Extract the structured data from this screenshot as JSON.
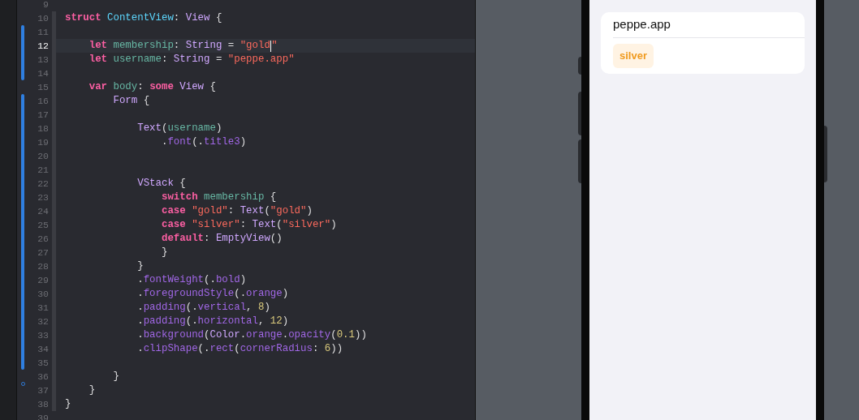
{
  "editor": {
    "lines": [
      {
        "number": "9",
        "current": false,
        "changed": false,
        "deleted": false,
        "fold": false
      },
      {
        "number": "10",
        "current": false,
        "changed": false,
        "deleted": false,
        "fold": true,
        "tokens": [
          {
            "kind": "keyword",
            "text": "struct"
          },
          {
            "kind": "decl",
            "text": " ContentView"
          },
          {
            "kind": "plain",
            "text": ": "
          },
          {
            "kind": "type",
            "text": "View"
          },
          {
            "kind": "plain",
            "text": " {"
          }
        ]
      },
      {
        "number": "11",
        "current": false,
        "changed": true,
        "deleted": false,
        "fold": true
      },
      {
        "number": "12",
        "current": true,
        "changed": true,
        "deleted": false,
        "fold": true,
        "tokens": [
          {
            "kind": "keyword",
            "text": "    let"
          },
          {
            "kind": "ident",
            "text": " membership"
          },
          {
            "kind": "plain",
            "text": ": "
          },
          {
            "kind": "type",
            "text": "String"
          },
          {
            "kind": "plain",
            "text": " = "
          },
          {
            "kind": "string",
            "text": "\"gold",
            "cursor": true
          },
          {
            "kind": "string",
            "text": "\""
          }
        ]
      },
      {
        "number": "13",
        "current": false,
        "changed": true,
        "deleted": false,
        "fold": true,
        "tokens": [
          {
            "kind": "keyword",
            "text": "    let"
          },
          {
            "kind": "ident",
            "text": " username"
          },
          {
            "kind": "plain",
            "text": ": "
          },
          {
            "kind": "type",
            "text": "String"
          },
          {
            "kind": "plain",
            "text": " = "
          },
          {
            "kind": "string",
            "text": "\"peppe.app\""
          }
        ]
      },
      {
        "number": "14",
        "current": false,
        "changed": true,
        "deleted": false,
        "fold": true
      },
      {
        "number": "15",
        "current": false,
        "changed": false,
        "deleted": false,
        "fold": true,
        "tokens": [
          {
            "kind": "keyword",
            "text": "    var"
          },
          {
            "kind": "ident",
            "text": " body"
          },
          {
            "kind": "plain",
            "text": ": "
          },
          {
            "kind": "keyword",
            "text": "some"
          },
          {
            "kind": "type",
            "text": " View"
          },
          {
            "kind": "plain",
            "text": " {"
          }
        ]
      },
      {
        "number": "16",
        "current": false,
        "changed": true,
        "deleted": false,
        "fold": true,
        "tokens": [
          {
            "kind": "type",
            "text": "        Form"
          },
          {
            "kind": "plain",
            "text": " {"
          }
        ]
      },
      {
        "number": "17",
        "current": false,
        "changed": true,
        "deleted": false,
        "fold": true
      },
      {
        "number": "18",
        "current": false,
        "changed": true,
        "deleted": false,
        "fold": true,
        "tokens": [
          {
            "kind": "type",
            "text": "            Text"
          },
          {
            "kind": "plain",
            "text": "("
          },
          {
            "kind": "ident",
            "text": "username"
          },
          {
            "kind": "plain",
            "text": ")"
          }
        ]
      },
      {
        "number": "19",
        "current": false,
        "changed": true,
        "deleted": false,
        "fold": true,
        "tokens": [
          {
            "kind": "plain",
            "text": "                ."
          },
          {
            "kind": "member",
            "text": "font"
          },
          {
            "kind": "plain",
            "text": "(."
          },
          {
            "kind": "member",
            "text": "title3"
          },
          {
            "kind": "plain",
            "text": ")"
          }
        ]
      },
      {
        "number": "20",
        "current": false,
        "changed": true,
        "deleted": false,
        "fold": true
      },
      {
        "number": "21",
        "current": false,
        "changed": true,
        "deleted": false,
        "fold": true
      },
      {
        "number": "22",
        "current": false,
        "changed": true,
        "deleted": false,
        "fold": true,
        "tokens": [
          {
            "kind": "type",
            "text": "            VStack"
          },
          {
            "kind": "plain",
            "text": " {"
          }
        ]
      },
      {
        "number": "23",
        "current": false,
        "changed": true,
        "deleted": false,
        "fold": true,
        "tokens": [
          {
            "kind": "keyword",
            "text": "                switch"
          },
          {
            "kind": "ident",
            "text": " membership"
          },
          {
            "kind": "plain",
            "text": " {"
          }
        ]
      },
      {
        "number": "24",
        "current": false,
        "changed": true,
        "deleted": false,
        "fold": true,
        "tokens": [
          {
            "kind": "keyword",
            "text": "                case"
          },
          {
            "kind": "string",
            "text": " \"gold\""
          },
          {
            "kind": "plain",
            "text": ": "
          },
          {
            "kind": "type",
            "text": "Text"
          },
          {
            "kind": "plain",
            "text": "("
          },
          {
            "kind": "string",
            "text": "\"gold\""
          },
          {
            "kind": "plain",
            "text": ")"
          }
        ]
      },
      {
        "number": "25",
        "current": false,
        "changed": true,
        "deleted": false,
        "fold": true,
        "tokens": [
          {
            "kind": "keyword",
            "text": "                case"
          },
          {
            "kind": "string",
            "text": " \"silver\""
          },
          {
            "kind": "plain",
            "text": ": "
          },
          {
            "kind": "type",
            "text": "Text"
          },
          {
            "kind": "plain",
            "text": "("
          },
          {
            "kind": "string",
            "text": "\"silver\""
          },
          {
            "kind": "plain",
            "text": ")"
          }
        ]
      },
      {
        "number": "26",
        "current": false,
        "changed": true,
        "deleted": false,
        "fold": true,
        "tokens": [
          {
            "kind": "keyword",
            "text": "                default"
          },
          {
            "kind": "plain",
            "text": ": "
          },
          {
            "kind": "type",
            "text": "EmptyView"
          },
          {
            "kind": "plain",
            "text": "()"
          }
        ]
      },
      {
        "number": "27",
        "current": false,
        "changed": true,
        "deleted": false,
        "fold": true,
        "tokens": [
          {
            "kind": "plain",
            "text": "                }"
          }
        ]
      },
      {
        "number": "28",
        "current": false,
        "changed": true,
        "deleted": false,
        "fold": true,
        "tokens": [
          {
            "kind": "plain",
            "text": "            }"
          }
        ]
      },
      {
        "number": "29",
        "current": false,
        "changed": true,
        "deleted": false,
        "fold": true,
        "tokens": [
          {
            "kind": "plain",
            "text": "            ."
          },
          {
            "kind": "member",
            "text": "fontWeight"
          },
          {
            "kind": "plain",
            "text": "(."
          },
          {
            "kind": "member",
            "text": "bold"
          },
          {
            "kind": "plain",
            "text": ")"
          }
        ]
      },
      {
        "number": "30",
        "current": false,
        "changed": true,
        "deleted": false,
        "fold": true,
        "tokens": [
          {
            "kind": "plain",
            "text": "            ."
          },
          {
            "kind": "member",
            "text": "foregroundStyle"
          },
          {
            "kind": "plain",
            "text": "(."
          },
          {
            "kind": "member",
            "text": "orange"
          },
          {
            "kind": "plain",
            "text": ")"
          }
        ]
      },
      {
        "number": "31",
        "current": false,
        "changed": true,
        "deleted": false,
        "fold": true,
        "tokens": [
          {
            "kind": "plain",
            "text": "            ."
          },
          {
            "kind": "member",
            "text": "padding"
          },
          {
            "kind": "plain",
            "text": "(."
          },
          {
            "kind": "member",
            "text": "vertical"
          },
          {
            "kind": "plain",
            "text": ", "
          },
          {
            "kind": "number",
            "text": "8"
          },
          {
            "kind": "plain",
            "text": ")"
          }
        ]
      },
      {
        "number": "32",
        "current": false,
        "changed": true,
        "deleted": false,
        "fold": true,
        "tokens": [
          {
            "kind": "plain",
            "text": "            ."
          },
          {
            "kind": "member",
            "text": "padding"
          },
          {
            "kind": "plain",
            "text": "(."
          },
          {
            "kind": "member",
            "text": "horizontal"
          },
          {
            "kind": "plain",
            "text": ", "
          },
          {
            "kind": "number",
            "text": "12"
          },
          {
            "kind": "plain",
            "text": ")"
          }
        ]
      },
      {
        "number": "33",
        "current": false,
        "changed": true,
        "deleted": false,
        "fold": true,
        "tokens": [
          {
            "kind": "plain",
            "text": "            ."
          },
          {
            "kind": "member",
            "text": "background"
          },
          {
            "kind": "plain",
            "text": "("
          },
          {
            "kind": "type",
            "text": "Color"
          },
          {
            "kind": "plain",
            "text": "."
          },
          {
            "kind": "member",
            "text": "orange"
          },
          {
            "kind": "plain",
            "text": "."
          },
          {
            "kind": "member",
            "text": "opacity"
          },
          {
            "kind": "plain",
            "text": "("
          },
          {
            "kind": "number",
            "text": "0.1"
          },
          {
            "kind": "plain",
            "text": "))"
          }
        ]
      },
      {
        "number": "34",
        "current": false,
        "changed": true,
        "deleted": false,
        "fold": true,
        "tokens": [
          {
            "kind": "plain",
            "text": "            ."
          },
          {
            "kind": "member",
            "text": "clipShape"
          },
          {
            "kind": "plain",
            "text": "(."
          },
          {
            "kind": "member",
            "text": "rect"
          },
          {
            "kind": "plain",
            "text": "("
          },
          {
            "kind": "member",
            "text": "cornerRadius"
          },
          {
            "kind": "plain",
            "text": ": "
          },
          {
            "kind": "number",
            "text": "6"
          },
          {
            "kind": "plain",
            "text": "))"
          }
        ]
      },
      {
        "number": "35",
        "current": false,
        "changed": true,
        "deleted": false,
        "fold": true
      },
      {
        "number": "36",
        "current": false,
        "changed": false,
        "deleted": false,
        "fold": true,
        "tokens": [
          {
            "kind": "plain",
            "text": "        }"
          }
        ]
      },
      {
        "number": "37",
        "current": false,
        "changed": false,
        "deleted": true,
        "fold": true,
        "tokens": [
          {
            "kind": "plain",
            "text": "    }"
          }
        ]
      },
      {
        "number": "38",
        "current": false,
        "changed": false,
        "deleted": false,
        "fold": true,
        "tokens": [
          {
            "kind": "plain",
            "text": "}"
          }
        ]
      },
      {
        "number": "39",
        "current": false,
        "changed": false,
        "deleted": false,
        "fold": false
      }
    ]
  },
  "preview": {
    "form": {
      "title": "peppe.app",
      "badge": "silver"
    }
  }
}
